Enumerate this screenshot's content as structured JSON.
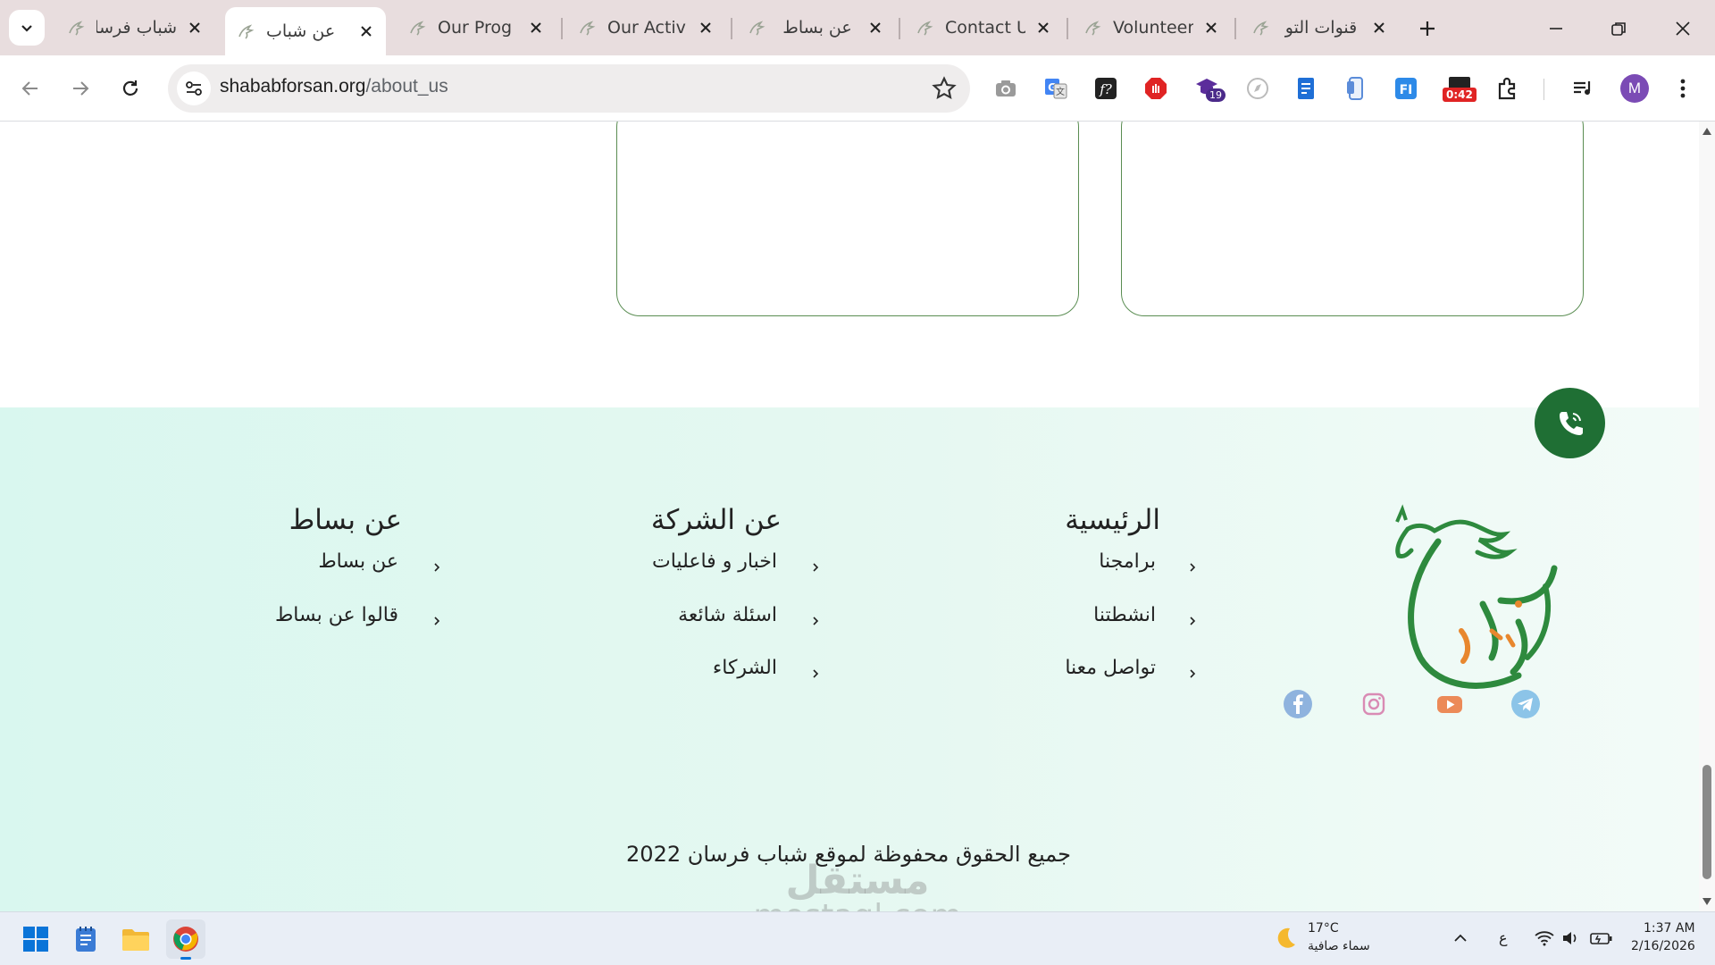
{
  "browser": {
    "tabs": [
      {
        "title": "شباب فرسا",
        "active": false
      },
      {
        "title": "عن شباب",
        "active": true
      },
      {
        "title": "Our Prog",
        "active": false
      },
      {
        "title": "Our Activ",
        "active": false
      },
      {
        "title": "عن بساط",
        "active": false
      },
      {
        "title": "Contact U",
        "active": false
      },
      {
        "title": "Volunteer",
        "active": false
      },
      {
        "title": "قنوات التو",
        "active": false
      }
    ],
    "url_host": "shababforsan.org",
    "url_path": "/about_us",
    "extension_badges": {
      "count": "19",
      "timer": "0:42"
    },
    "profile_initial": "M"
  },
  "footer": {
    "columns": [
      {
        "title": "الرئيسية",
        "links": [
          "برامجنا",
          "انشطتنا",
          "تواصل معنا"
        ]
      },
      {
        "title": "عن الشركة",
        "links": [
          "اخبار و فاعليات",
          "اسئلة شائعة",
          "الشركاء"
        ]
      },
      {
        "title": "عن بساط",
        "links": [
          "عن بساط",
          "قالوا عن بساط"
        ]
      }
    ],
    "copyright": "جميع الحقوق محفوظة لموقع شباب فرسان 2022",
    "social": [
      "facebook-icon",
      "instagram-icon",
      "youtube-icon",
      "telegram-icon"
    ]
  },
  "watermark": {
    "arabic": "مستقل",
    "latin": "mostaql.com"
  },
  "taskbar": {
    "weather_temp": "17°C",
    "weather_desc": "سماء صافية",
    "lang": "ع",
    "time": "1:37 AM",
    "date": "2/16/2026"
  },
  "colors": {
    "brand_green": "#1f6f34",
    "card_border": "#5a8d52",
    "footer_bg": "#d9f7ef"
  }
}
